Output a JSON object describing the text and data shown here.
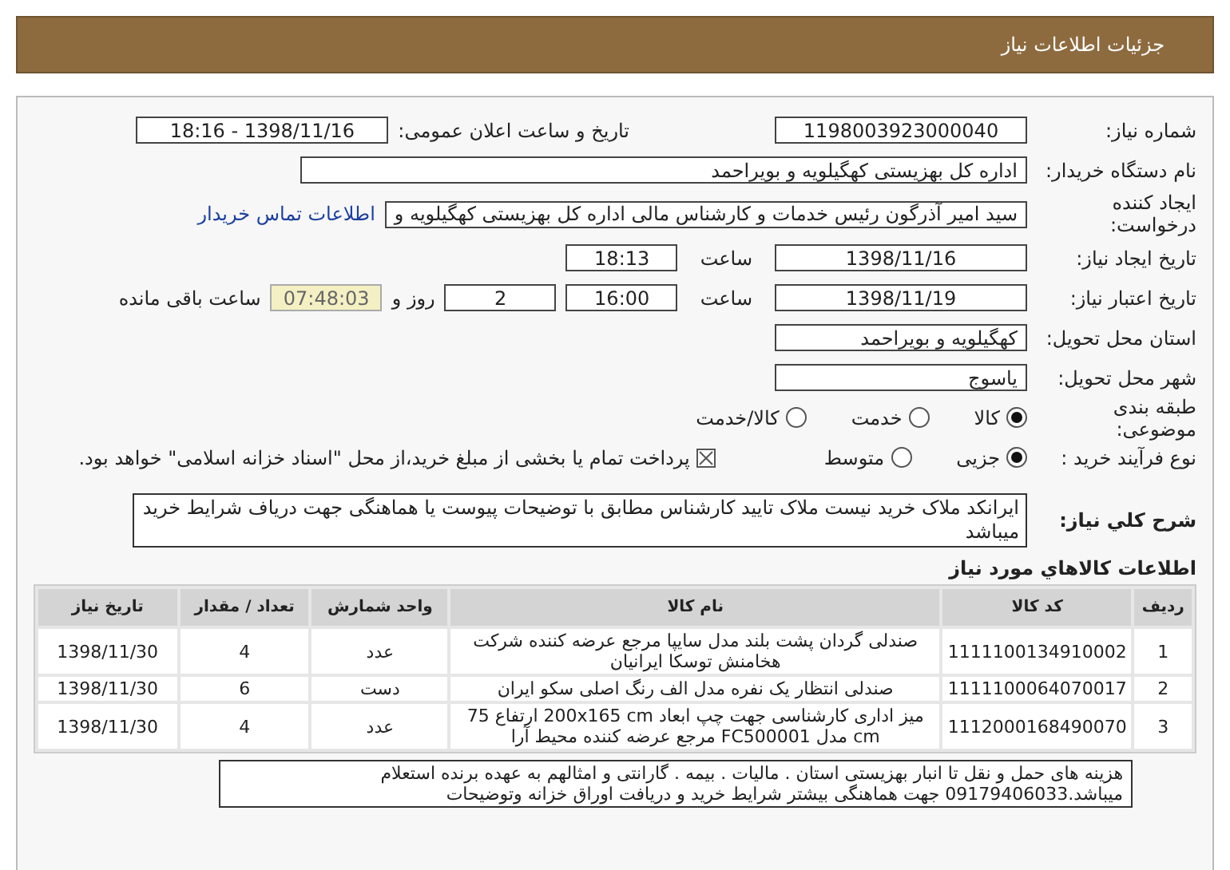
{
  "header": {
    "title": "جزئیات اطلاعات نیاز"
  },
  "fields": {
    "need_number": {
      "label": "شماره نیاز:",
      "value": "1198003923000040"
    },
    "announce": {
      "label": "تاریخ و ساعت اعلان عمومی:",
      "value": "1398/11/16 - 18:16"
    },
    "buyer": {
      "label": "نام دستگاه خریدار:",
      "value": "اداره کل بهزیستی کهگیلویه و بویراحمد"
    },
    "creator": {
      "label": "ایجاد کننده درخواست:",
      "value": "سید امیر آذرگون رئیس خدمات و کارشناس مالی اداره کل بهزیستی کهگیلویه و",
      "link": "اطلاعات تماس خریدار"
    },
    "created": {
      "label": "تاریخ ایجاد نیاز:",
      "date": "1398/11/16",
      "time_label": "ساعت",
      "time": "18:13"
    },
    "valid": {
      "label": "تاریخ اعتبار نیاز:",
      "date": "1398/11/19",
      "time_label": "ساعت",
      "time": "16:00",
      "days": "2",
      "days_label": "روز و",
      "remaining": "07:48:03",
      "remaining_label": "ساعت باقی مانده"
    },
    "province": {
      "label": "استان محل تحویل:",
      "value": "کهگیلویه و بویراحمد"
    },
    "city": {
      "label": "شهر محل تحویل:",
      "value": "یاسوج"
    }
  },
  "category": {
    "label": "طبقه بندی موضوعی:",
    "options": [
      {
        "label": "کالا",
        "selected": true
      },
      {
        "label": "خدمت",
        "selected": false
      },
      {
        "label": "کالا/خدمت",
        "selected": false
      }
    ]
  },
  "process": {
    "label": "نوع فرآیند خرید :",
    "options": [
      {
        "label": "جزیی",
        "selected": true
      },
      {
        "label": "متوسط",
        "selected": false
      }
    ],
    "treasury": {
      "label": "پرداخت تمام یا بخشی از مبلغ خرید،از محل \"اسناد خزانه اسلامی\" خواهد بود.",
      "checked": true
    }
  },
  "description": {
    "label": "شرح کلي نياز:",
    "text": "ایرانکد ملاک خرید نیست ملاک تایید کارشناس مطابق با توضیحات پیوست یا هماهنگی جهت دریاف شرایط خرید میباشد"
  },
  "goods": {
    "title": "اطلاعات کالاهاي مورد نياز",
    "columns": [
      "ردیف",
      "کد کالا",
      "نام کالا",
      "واحد شمارش",
      "تعداد / مقدار",
      "تاریخ نیاز"
    ],
    "rows": [
      [
        "1",
        "1111100134910002",
        "صندلی گردان پشت بلند مدل سایپا مرجع عرضه کننده شرکت هخامنش توسکا ایرانیان",
        "عدد",
        "4",
        "1398/11/30"
      ],
      [
        "2",
        "1111100064070017",
        "صندلی انتظار یک نفره مدل الف رنگ اصلی سکو ایران",
        "دست",
        "6",
        "1398/11/30"
      ],
      [
        "3",
        "1112000168490070",
        "میز اداری کارشناسی جهت چپ ابعاد 200x165 cm ارتفاع 75 cm مدل FC500001 مرجع عرضه کننده محیط آرا",
        "عدد",
        "4",
        "1398/11/30"
      ]
    ]
  },
  "buyer_notes": {
    "text": "هزینه های حمل و نقل تا انبار بهزیستی استان . مالیات . بیمه . گارانتی و امثالهم به عهده برنده استعلام میباشد.09179406033 جهت هماهنگی بیشتر شرایط خرید و دریافت اوراق خزانه وتوضیحات"
  }
}
